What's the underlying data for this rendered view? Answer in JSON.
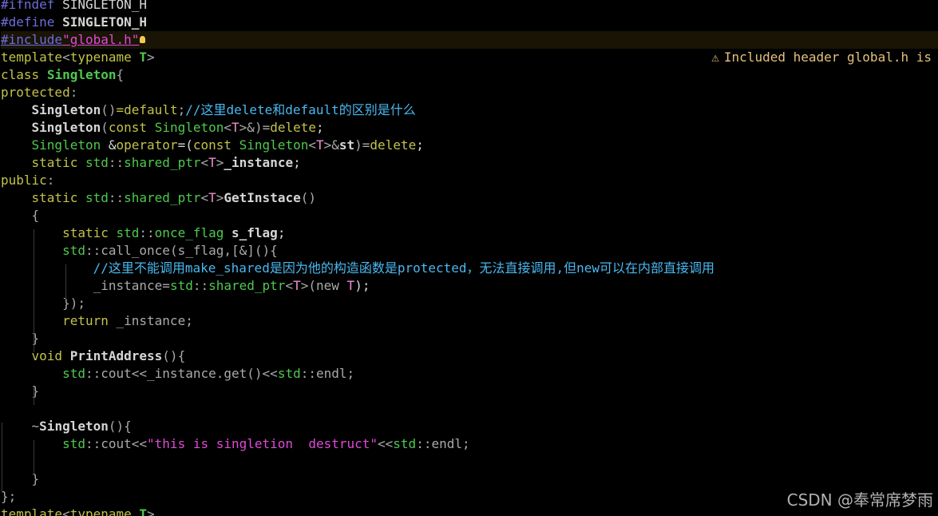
{
  "colors": {
    "background": "#000000",
    "preproc": "#6d6dd9",
    "keyword": "#c2c24a",
    "typeName": "#4ec94e",
    "template_type": "#f08dd1",
    "punct": "#a9a9a9",
    "plain": "#d6d6d6",
    "comment": "#4ab8f0",
    "string": "#e04ad6",
    "warning": "#e5c07b"
  },
  "editor": {
    "lines": [
      {
        "tokens": [
          {
            "t": "#ifndef",
            "c": "preproc"
          },
          {
            "t": " SINGLETON_H",
            "c": "plain"
          }
        ]
      },
      {
        "tokens": [
          {
            "t": "#define",
            "c": "preproc"
          },
          {
            "t": " SINGLETON_H",
            "c": "plain",
            "bold": true
          }
        ]
      },
      {
        "hl": true,
        "tokens": [
          {
            "t": "#include",
            "c": "preproc",
            "u": true
          },
          {
            "t": "\"global.h\"",
            "c": "string",
            "u": true
          }
        ],
        "bulb": true
      },
      {
        "tokens": [
          {
            "t": "template",
            "c": "keyword"
          },
          {
            "t": "<",
            "c": "punct"
          },
          {
            "t": "typename",
            "c": "keyword"
          },
          {
            "t": " ",
            "c": "plain"
          },
          {
            "t": "T",
            "c": "typeName",
            "bold": true
          },
          {
            "t": ">",
            "c": "punct"
          }
        ]
      },
      {
        "tokens": [
          {
            "t": "class",
            "c": "keyword"
          },
          {
            "t": " ",
            "c": "plain"
          },
          {
            "t": "Singleton",
            "c": "typeName",
            "bold": true
          },
          {
            "t": "{",
            "c": "punct"
          }
        ]
      },
      {
        "tokens": [
          {
            "t": "protected",
            "c": "keyword"
          },
          {
            "t": ":",
            "c": "punct"
          }
        ]
      },
      {
        "tokens": [
          {
            "t": "    ",
            "c": "plain"
          },
          {
            "t": "Singleton",
            "c": "plain",
            "bold": true
          },
          {
            "t": "()",
            "c": "punct"
          },
          {
            "t": "=",
            "c": "keyword"
          },
          {
            "t": "default",
            "c": "keyword"
          },
          {
            "t": ";",
            "c": "punct"
          },
          {
            "t": "//这里delete和default的区别是什么",
            "c": "comment"
          }
        ]
      },
      {
        "tokens": [
          {
            "t": "    ",
            "c": "plain"
          },
          {
            "t": "Singleton",
            "c": "plain",
            "bold": true
          },
          {
            "t": "(",
            "c": "punct"
          },
          {
            "t": "const",
            "c": "keyword"
          },
          {
            "t": " ",
            "c": "plain"
          },
          {
            "t": "Singleton",
            "c": "typeName"
          },
          {
            "t": "<",
            "c": "punct"
          },
          {
            "t": "T",
            "c": "template_type"
          },
          {
            "t": ">&",
            "c": "punct"
          },
          {
            "t": ")=",
            "c": "punct"
          },
          {
            "t": "delete",
            "c": "keyword"
          },
          {
            "t": ";",
            "c": "plain"
          }
        ]
      },
      {
        "tokens": [
          {
            "t": "    ",
            "c": "plain"
          },
          {
            "t": "Singleton",
            "c": "typeName"
          },
          {
            "t": " &",
            "c": "plain"
          },
          {
            "t": "operator",
            "c": "keyword"
          },
          {
            "t": "=(",
            "c": "plain"
          },
          {
            "t": "const",
            "c": "keyword"
          },
          {
            "t": " ",
            "c": "plain"
          },
          {
            "t": "Singleton",
            "c": "typeName"
          },
          {
            "t": "<",
            "c": "punct"
          },
          {
            "t": "T",
            "c": "template_type"
          },
          {
            "t": ">&",
            "c": "punct"
          },
          {
            "t": "st",
            "c": "plain",
            "bold": true
          },
          {
            "t": ")=",
            "c": "punct"
          },
          {
            "t": "delete",
            "c": "keyword"
          },
          {
            "t": ";",
            "c": "plain"
          }
        ]
      },
      {
        "tokens": [
          {
            "t": "    ",
            "c": "plain"
          },
          {
            "t": "static",
            "c": "keyword"
          },
          {
            "t": " ",
            "c": "plain"
          },
          {
            "t": "std",
            "c": "typeName"
          },
          {
            "t": "::",
            "c": "punct"
          },
          {
            "t": "shared_ptr",
            "c": "typeName"
          },
          {
            "t": "<",
            "c": "punct"
          },
          {
            "t": "T",
            "c": "template_type"
          },
          {
            "t": ">",
            "c": "punct"
          },
          {
            "t": "_instance",
            "c": "plain",
            "bold": true
          },
          {
            "t": ";",
            "c": "plain"
          }
        ]
      },
      {
        "tokens": [
          {
            "t": "public",
            "c": "keyword"
          },
          {
            "t": ":",
            "c": "punct"
          }
        ]
      },
      {
        "tokens": [
          {
            "t": "    ",
            "c": "plain"
          },
          {
            "t": "static",
            "c": "keyword"
          },
          {
            "t": " ",
            "c": "plain"
          },
          {
            "t": "std",
            "c": "typeName"
          },
          {
            "t": "::",
            "c": "punct"
          },
          {
            "t": "shared_ptr",
            "c": "typeName"
          },
          {
            "t": "<",
            "c": "punct"
          },
          {
            "t": "T",
            "c": "template_type"
          },
          {
            "t": ">",
            "c": "punct"
          },
          {
            "t": "GetInstace",
            "c": "plain",
            "bold": true
          },
          {
            "t": "()",
            "c": "punct"
          }
        ]
      },
      {
        "tokens": [
          {
            "t": "    ",
            "c": "plain"
          },
          {
            "t": "{",
            "c": "punct"
          }
        ]
      },
      {
        "tokens": [
          {
            "t": "        ",
            "c": "plain"
          },
          {
            "t": "static",
            "c": "keyword"
          },
          {
            "t": " ",
            "c": "plain"
          },
          {
            "t": "std",
            "c": "typeName"
          },
          {
            "t": "::",
            "c": "punct"
          },
          {
            "t": "once_flag",
            "c": "typeName"
          },
          {
            "t": " ",
            "c": "plain"
          },
          {
            "t": "s_flag",
            "c": "plain",
            "bold": true
          },
          {
            "t": ";",
            "c": "plain"
          }
        ]
      },
      {
        "tokens": [
          {
            "t": "        ",
            "c": "plain"
          },
          {
            "t": "std",
            "c": "typeName"
          },
          {
            "t": "::",
            "c": "punct"
          },
          {
            "t": "call_once",
            "c": "punct"
          },
          {
            "t": "(",
            "c": "punct"
          },
          {
            "t": "s_flag",
            "c": "punct"
          },
          {
            "t": ",[&](){",
            "c": "punct"
          }
        ]
      },
      {
        "tokens": [
          {
            "t": "            ",
            "c": "plain"
          },
          {
            "t": "//这里不能调用make_shared是因为他的构造函数是protected，无法直接调用,但new可以在内部直接调用",
            "c": "comment"
          }
        ]
      },
      {
        "tokens": [
          {
            "t": "            ",
            "c": "plain"
          },
          {
            "t": "_instance",
            "c": "punct"
          },
          {
            "t": "=",
            "c": "punct"
          },
          {
            "t": "std",
            "c": "typeName"
          },
          {
            "t": "::",
            "c": "punct"
          },
          {
            "t": "shared_ptr",
            "c": "typeName"
          },
          {
            "t": "<",
            "c": "punct"
          },
          {
            "t": "T",
            "c": "template_type"
          },
          {
            "t": ">",
            "c": "punct"
          },
          {
            "t": "(",
            "c": "punct"
          },
          {
            "t": "new",
            "c": "punct"
          },
          {
            "t": " ",
            "c": "plain"
          },
          {
            "t": "T",
            "c": "template_type"
          },
          {
            "t": ");",
            "c": "plain"
          }
        ]
      },
      {
        "tokens": [
          {
            "t": "        ",
            "c": "plain"
          },
          {
            "t": "});",
            "c": "punct"
          }
        ]
      },
      {
        "tokens": [
          {
            "t": "        ",
            "c": "plain"
          },
          {
            "t": "return",
            "c": "keyword"
          },
          {
            "t": " ",
            "c": "plain"
          },
          {
            "t": "_instance",
            "c": "punct"
          },
          {
            "t": ";",
            "c": "punct"
          }
        ]
      },
      {
        "tokens": [
          {
            "t": "    ",
            "c": "plain"
          },
          {
            "t": "}",
            "c": "punct"
          }
        ]
      },
      {
        "tokens": [
          {
            "t": "    ",
            "c": "plain"
          },
          {
            "t": "void",
            "c": "keyword"
          },
          {
            "t": " ",
            "c": "plain"
          },
          {
            "t": "PrintAddress",
            "c": "plain",
            "bold": true
          },
          {
            "t": "(){",
            "c": "punct"
          }
        ]
      },
      {
        "tokens": [
          {
            "t": "        ",
            "c": "plain"
          },
          {
            "t": "std",
            "c": "typeName"
          },
          {
            "t": "::",
            "c": "punct"
          },
          {
            "t": "cout",
            "c": "punct"
          },
          {
            "t": "<<",
            "c": "punct"
          },
          {
            "t": "_instance",
            "c": "punct"
          },
          {
            "t": ".",
            "c": "punct"
          },
          {
            "t": "get",
            "c": "punct"
          },
          {
            "t": "()",
            "c": "punct"
          },
          {
            "t": "<<",
            "c": "punct"
          },
          {
            "t": "std",
            "c": "typeName"
          },
          {
            "t": "::",
            "c": "punct"
          },
          {
            "t": "endl",
            "c": "punct"
          },
          {
            "t": ";",
            "c": "punct"
          }
        ]
      },
      {
        "tokens": [
          {
            "t": "    ",
            "c": "plain"
          },
          {
            "t": "}",
            "c": "punct"
          }
        ]
      },
      {
        "tokens": [
          {
            "t": "",
            "c": "plain"
          }
        ]
      },
      {
        "tokens": [
          {
            "t": "    ",
            "c": "plain"
          },
          {
            "t": "~",
            "c": "punct"
          },
          {
            "t": "Singleton",
            "c": "plain",
            "bold": true
          },
          {
            "t": "(){",
            "c": "punct"
          }
        ]
      },
      {
        "tokens": [
          {
            "t": "        ",
            "c": "plain"
          },
          {
            "t": "std",
            "c": "typeName"
          },
          {
            "t": "::",
            "c": "punct"
          },
          {
            "t": "cout",
            "c": "punct"
          },
          {
            "t": "<<",
            "c": "punct"
          },
          {
            "t": "\"this is singletion  destruct\"",
            "c": "string"
          },
          {
            "t": "<<",
            "c": "punct"
          },
          {
            "t": "std",
            "c": "typeName"
          },
          {
            "t": "::",
            "c": "punct"
          },
          {
            "t": "endl",
            "c": "punct"
          },
          {
            "t": ";",
            "c": "punct"
          }
        ]
      },
      {
        "tokens": [
          {
            "t": "",
            "c": "plain"
          }
        ]
      },
      {
        "tokens": [
          {
            "t": "    ",
            "c": "plain"
          },
          {
            "t": "}",
            "c": "punct"
          }
        ]
      },
      {
        "tokens": [
          {
            "t": "};",
            "c": "punct"
          }
        ]
      },
      {
        "tokens": [
          {
            "t": "template",
            "c": "keyword"
          },
          {
            "t": "<",
            "c": "punct"
          },
          {
            "t": "typename",
            "c": "keyword"
          },
          {
            "t": " ",
            "c": "plain"
          },
          {
            "t": "T",
            "c": "typeName",
            "bold": true
          },
          {
            "t": ">",
            "c": "punct"
          }
        ]
      }
    ]
  },
  "diagnostic": {
    "icon": "warning-triangle-icon",
    "text": "Included header global.h is"
  },
  "watermark": {
    "text": "CSDN @奉常席梦雨"
  }
}
